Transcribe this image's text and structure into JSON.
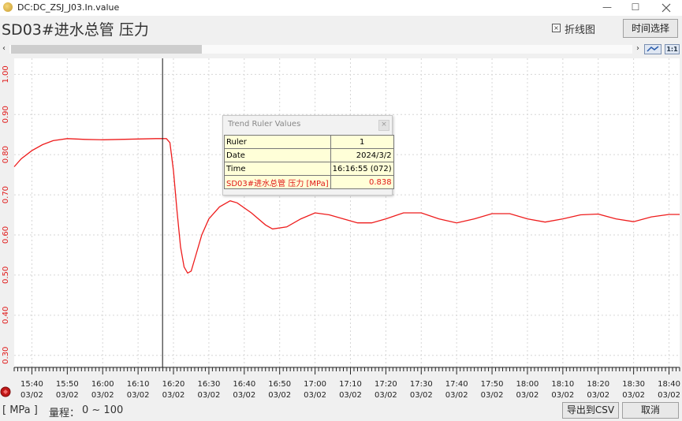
{
  "window": {
    "title": "DC:DC_ZSJ_J03.In.value",
    "minimize": "—",
    "maximize": "☐"
  },
  "header": {
    "title": "SD03#进水总管 压力",
    "line_chart_checkbox": {
      "label": "折线图",
      "checked": true
    },
    "time_select_button": "时间选择"
  },
  "scroll": {
    "left_arrow": "‹",
    "right_arrow": "›",
    "zoom_label": "1:1"
  },
  "chart_data": {
    "type": "line",
    "title": "",
    "xlabel": "",
    "ylabel": "",
    "ylim": [
      0.27,
      1.04
    ],
    "yticks": [
      "0.30",
      "0.40",
      "0.50",
      "0.60",
      "0.70",
      "0.80",
      "0.90",
      "1.00"
    ],
    "xticks": [
      [
        "15:40",
        "03/02"
      ],
      [
        "15:50",
        "03/02"
      ],
      [
        "16:00",
        "03/02"
      ],
      [
        "16:10",
        "03/02"
      ],
      [
        "16:20",
        "03/02"
      ],
      [
        "16:30",
        "03/02"
      ],
      [
        "16:40",
        "03/02"
      ],
      [
        "16:50",
        "03/02"
      ],
      [
        "17:00",
        "03/02"
      ],
      [
        "17:10",
        "03/02"
      ],
      [
        "17:20",
        "03/02"
      ],
      [
        "17:30",
        "03/02"
      ],
      [
        "17:40",
        "03/02"
      ],
      [
        "17:50",
        "03/02"
      ],
      [
        "18:00",
        "03/02"
      ],
      [
        "18:10",
        "03/02"
      ],
      [
        "18:20",
        "03/02"
      ],
      [
        "18:30",
        "03/02"
      ],
      [
        "18:40",
        "03/02"
      ]
    ],
    "xrange": [
      "15:35",
      "18:43"
    ],
    "ruler_time": "16:16:55",
    "grid": true,
    "series": [
      {
        "color": "#ee1c1c",
        "points": [
          [
            "15:35",
            0.77
          ],
          [
            "15:37",
            0.79
          ],
          [
            "15:40",
            0.81
          ],
          [
            "15:43",
            0.825
          ],
          [
            "15:46",
            0.835
          ],
          [
            "15:50",
            0.84
          ],
          [
            "15:55",
            0.838
          ],
          [
            "16:00",
            0.837
          ],
          [
            "16:05",
            0.838
          ],
          [
            "16:10",
            0.839
          ],
          [
            "16:15",
            0.84
          ],
          [
            "16:18",
            0.84
          ],
          [
            "16:19",
            0.83
          ],
          [
            "16:20",
            0.76
          ],
          [
            "16:21",
            0.66
          ],
          [
            "16:22",
            0.57
          ],
          [
            "16:23",
            0.52
          ],
          [
            "16:24",
            0.505
          ],
          [
            "16:25",
            0.51
          ],
          [
            "16:26",
            0.54
          ],
          [
            "16:28",
            0.6
          ],
          [
            "16:30",
            0.64
          ],
          [
            "16:33",
            0.67
          ],
          [
            "16:36",
            0.685
          ],
          [
            "16:38",
            0.68
          ],
          [
            "16:42",
            0.655
          ],
          [
            "16:46",
            0.625
          ],
          [
            "16:48",
            0.615
          ],
          [
            "16:52",
            0.62
          ],
          [
            "16:56",
            0.64
          ],
          [
            "17:00",
            0.655
          ],
          [
            "17:04",
            0.65
          ],
          [
            "17:08",
            0.64
          ],
          [
            "17:12",
            0.63
          ],
          [
            "17:16",
            0.63
          ],
          [
            "17:20",
            0.64
          ],
          [
            "17:25",
            0.655
          ],
          [
            "17:30",
            0.655
          ],
          [
            "17:35",
            0.64
          ],
          [
            "17:40",
            0.63
          ],
          [
            "17:45",
            0.64
          ],
          [
            "17:50",
            0.653
          ],
          [
            "17:55",
            0.653
          ],
          [
            "18:00",
            0.64
          ],
          [
            "18:05",
            0.632
          ],
          [
            "18:10",
            0.64
          ],
          [
            "18:15",
            0.65
          ],
          [
            "18:20",
            0.652
          ],
          [
            "18:25",
            0.64
          ],
          [
            "18:30",
            0.633
          ],
          [
            "18:35",
            0.645
          ],
          [
            "18:40",
            0.651
          ],
          [
            "18:43",
            0.651
          ]
        ]
      }
    ]
  },
  "ruler": {
    "title": "Trend Ruler Values",
    "close": "×",
    "rows": [
      {
        "label": "Ruler",
        "value": "1"
      },
      {
        "label": "Date",
        "value": "2024/3/2"
      },
      {
        "label": "Time",
        "value": "16:16:55 (072)"
      },
      {
        "label": "SD03#进水总管 压力 [MPa]",
        "value": "0.838"
      }
    ]
  },
  "status": {
    "unit": "[ MPa ]",
    "range_label": "量程：",
    "range_value": "0 ~ 100",
    "export_button": "导出到CSV",
    "cancel_button": "取消"
  }
}
